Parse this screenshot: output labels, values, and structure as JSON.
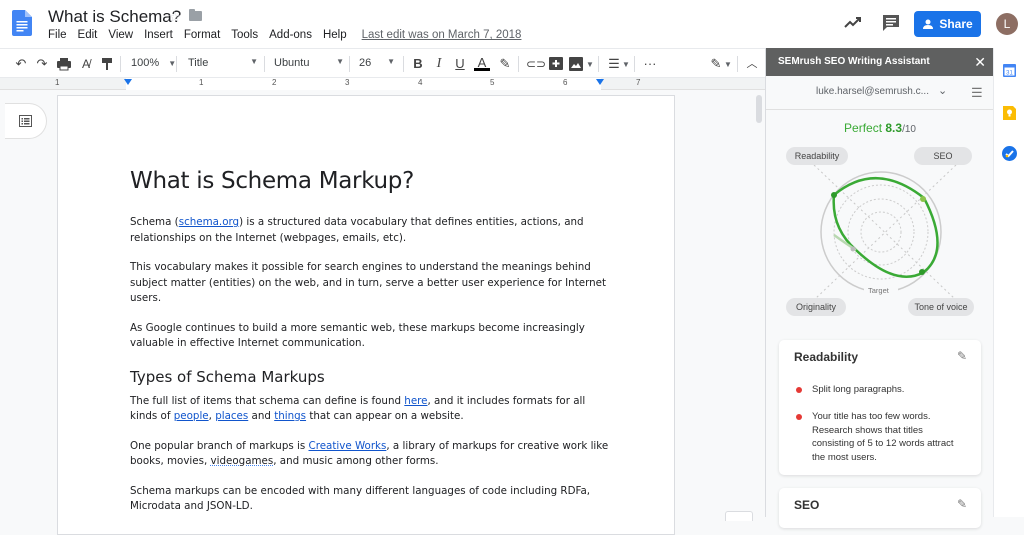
{
  "app": {
    "doc_title": "What is Schema?",
    "menu": [
      "File",
      "Edit",
      "View",
      "Insert",
      "Format",
      "Tools",
      "Add-ons",
      "Help"
    ],
    "last_edit": "Last edit was on March 7, 2018",
    "share_label": "Share",
    "avatar_initial": "L"
  },
  "toolbar": {
    "zoom": "100%",
    "style": "Title",
    "font": "Ubuntu",
    "font_size": "26",
    "bold": "B",
    "italic": "I",
    "underline": "U",
    "text_color": "A",
    "more": "···"
  },
  "ruler": {
    "labels": [
      "1",
      "1",
      "2",
      "3",
      "4",
      "5",
      "6",
      "7"
    ]
  },
  "document": {
    "heading": "What is Schema Markup?",
    "p1_a": "Schema (",
    "p1_link": "schema.org",
    "p1_b": ") is a structured data vocabulary that defines entities, actions, and relationships on the Internet (webpages, emails, etc).",
    "p2": "This vocabulary makes it possible for search engines to understand the meanings behind subject matter (entities) on the web, and in turn, serve a better user experience for Internet users.",
    "p3": "As Google continues to build a more semantic web, these markups become increasingly valuable in effective Internet communication.",
    "subheading": "Types of Schema Markups",
    "p4_a": "The full list of items that schema can define is found ",
    "p4_link_here": "here",
    "p4_b": ", and it includes formats for all kinds of ",
    "p4_link_people": "people",
    "p4_c": ", ",
    "p4_link_places": "places",
    "p4_d": " and ",
    "p4_link_things": "things",
    "p4_e": " that can appear on a website.",
    "p5_a": "One popular branch of markups is ",
    "p5_link": "Creative Works",
    "p5_b": ", a library of markups for creative work like books, movies, ",
    "p5_spell": "videogames",
    "p5_c": ", and music among other forms.",
    "p6": "Schema markups can be encoded with many different languages of code including RDFa, Microdata and JSON-LD."
  },
  "semrush": {
    "title": "SEMrush SEO Writing Assistant",
    "account": "luke.harsel@semrush.c...",
    "score_label": "Perfect",
    "score": "8.3",
    "score_max": "/10",
    "score_color": "#3aaa35",
    "radar_labels": {
      "readability": "Readability",
      "seo": "SEO",
      "originality": "Originality",
      "tone": "Tone of voice",
      "target": "Target"
    },
    "cards": [
      {
        "title": "Readability",
        "items": [
          "Split long paragraphs.",
          "Your title has too few words. Research shows that titles consisting of 5 to 12 words attract the most users."
        ]
      },
      {
        "title": "SEO",
        "items": []
      }
    ]
  },
  "colors": {
    "accent": "#1a73e8",
    "link": "#1155cc",
    "warning_bullet": "#e53935",
    "panel_header": "#5f6060"
  }
}
